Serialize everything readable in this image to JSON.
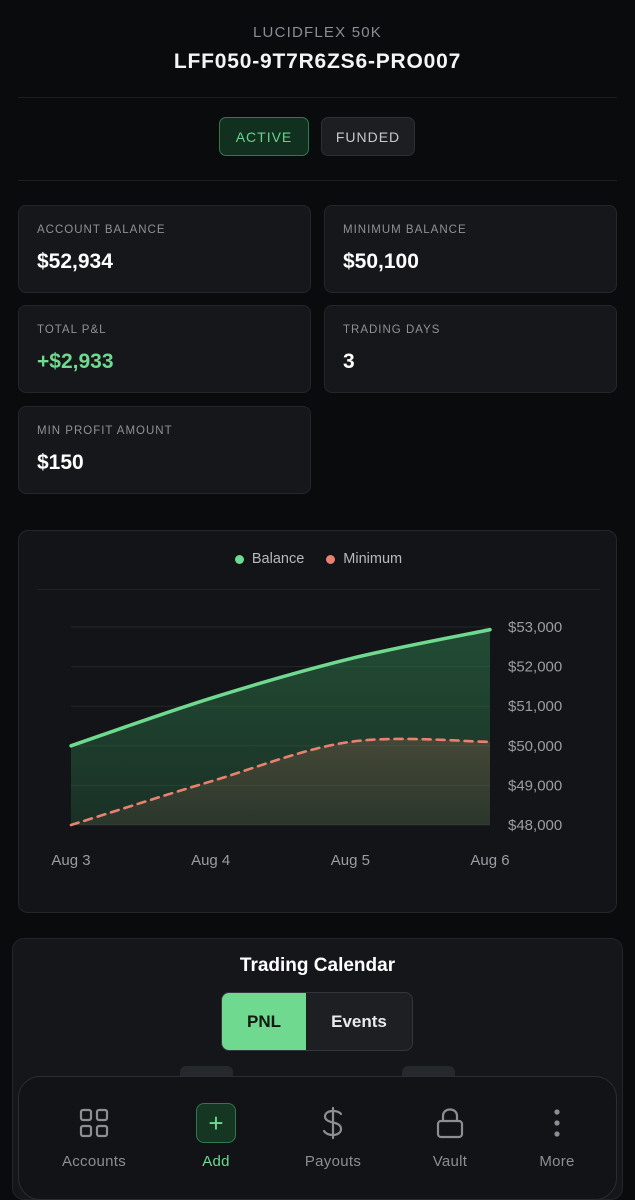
{
  "header": {
    "account_type": "LUCIDFLEX 50K",
    "account_id": "LFF050-9T7R6ZS6-PRO007"
  },
  "badges": {
    "active": "ACTIVE",
    "funded": "FUNDED"
  },
  "stats": {
    "account_balance": {
      "label": "ACCOUNT BALANCE",
      "value": "$52,934"
    },
    "minimum_balance": {
      "label": "MINIMUM BALANCE",
      "value": "$50,100"
    },
    "total_pnl": {
      "label": "TOTAL P&L",
      "value": "+$2,933"
    },
    "trading_days": {
      "label": "TRADING DAYS",
      "value": "3"
    },
    "min_profit": {
      "label": "MIN PROFIT AMOUNT",
      "value": "$150"
    }
  },
  "colors": {
    "accent_green": "#6fd98f",
    "minimum_salmon": "#e8826f",
    "background": "#0a0b0d",
    "card": "#15171a"
  },
  "chart_data": {
    "type": "area",
    "x": [
      "Aug 3",
      "Aug 4",
      "Aug 5",
      "Aug 6"
    ],
    "series": [
      {
        "name": "Balance",
        "values": [
          50000,
          51200,
          52200,
          52934
        ],
        "color": "#6fd98f",
        "style": "solid"
      },
      {
        "name": "Minimum",
        "values": [
          48000,
          49100,
          50100,
          50100
        ],
        "color": "#e8826f",
        "style": "dashed"
      }
    ],
    "yticks": [
      "$53,000",
      "$52,000",
      "$51,000",
      "$50,000",
      "$49,000",
      "$48,000"
    ],
    "ylim": [
      48000,
      53000
    ],
    "y_axis_side": "right",
    "grid": true,
    "legend_position": "top-center"
  },
  "calendar": {
    "title": "Trading Calendar",
    "tabs": [
      "PNL",
      "Events"
    ],
    "selected": "PNL"
  },
  "nav": {
    "items": [
      {
        "label": "Accounts",
        "icon": "grid-icon"
      },
      {
        "label": "Add",
        "icon": "plus-icon"
      },
      {
        "label": "Payouts",
        "icon": "dollar-icon"
      },
      {
        "label": "Vault",
        "icon": "lock-icon"
      },
      {
        "label": "More",
        "icon": "more-vertical-icon"
      }
    ],
    "selected": "Add"
  }
}
